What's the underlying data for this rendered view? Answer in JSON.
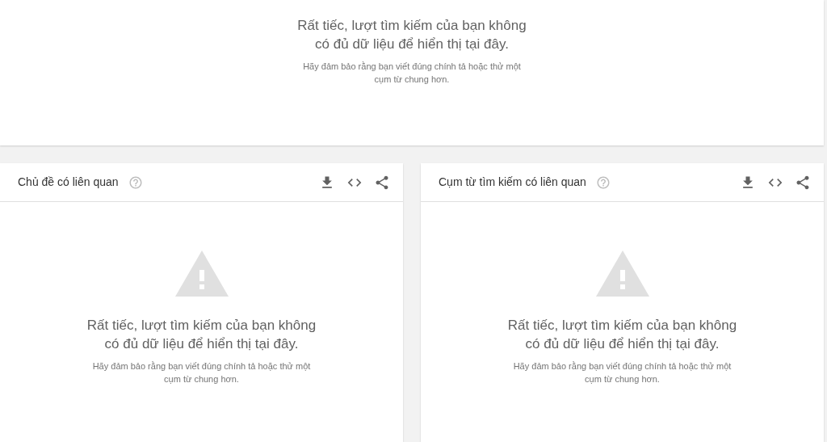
{
  "top_message": {
    "title": "Rất tiếc, lượt tìm kiếm của bạn không có đủ dữ liệu để hiển thị tại đây.",
    "hint": "Hãy đảm bảo rằng bạn viết đúng chính tả hoặc thử một cụm từ chung hơn."
  },
  "panels": [
    {
      "title": "Chủ đề có liên quan",
      "message": "Rất tiếc, lượt tìm kiếm của bạn không có đủ dữ liệu để hiển thị tại đây.",
      "hint": "Hãy đảm bảo rằng bạn viết đúng chính tả hoặc thử một cụm từ chung hơn."
    },
    {
      "title": "Cụm từ tìm kiếm có liên quan",
      "message": "Rất tiếc, lượt tìm kiếm của bạn không có đủ dữ liệu để hiển thị tại đây.",
      "hint": "Hãy đảm bảo rằng bạn viết đúng chính tả hoặc thử một cụm từ chung hơn."
    }
  ]
}
